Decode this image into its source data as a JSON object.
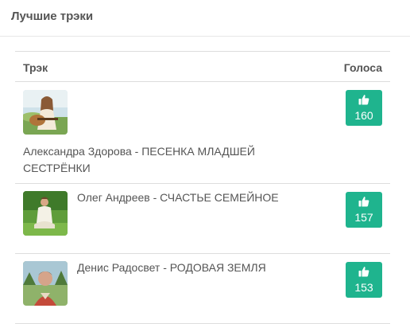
{
  "panel": {
    "title": "Лучшие трэки"
  },
  "table": {
    "columns": {
      "track": "Трэк",
      "votes": "Голоса"
    },
    "rows": [
      {
        "title": "Александра Здорова - ПЕСЕНКА МЛАДШЕЙ СЕСТРЁНКИ",
        "votes": "160",
        "image": "singer-guitar-thumbnail"
      },
      {
        "title": "Олег Андреев - СЧАСТЬЕ СЕМЕЙНОЕ",
        "votes": "157",
        "image": "man-sitting-grass-thumbnail"
      },
      {
        "title": "Денис Радосвет - РОДОВАЯ ЗЕМЛЯ",
        "votes": "153",
        "image": "man-portrait-thumbnail"
      }
    ]
  },
  "icons": {
    "vote": "thumbs-up-icon"
  },
  "colors": {
    "accent": "#1fb48e",
    "text": "#555555",
    "border": "#dddddd"
  }
}
